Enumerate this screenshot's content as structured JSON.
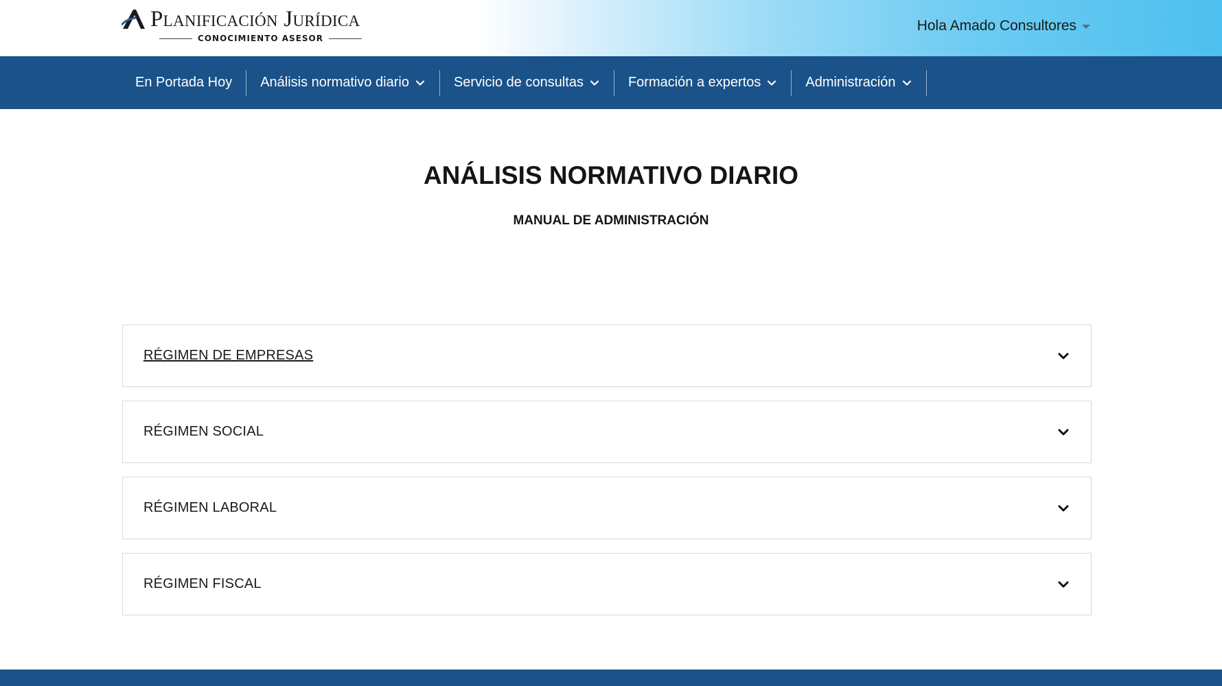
{
  "header": {
    "logo_title": "Planificación Jurídica",
    "logo_subtitle": "CONOCIMIENTO ASESOR",
    "user_greeting": "Hola Amado Consultores"
  },
  "nav": {
    "items": [
      {
        "label": "En Portada Hoy",
        "has_dropdown": false
      },
      {
        "label": "Análisis normativo diario",
        "has_dropdown": true
      },
      {
        "label": "Servicio de consultas",
        "has_dropdown": true
      },
      {
        "label": "Formación a expertos",
        "has_dropdown": true
      },
      {
        "label": "Administración",
        "has_dropdown": true
      }
    ]
  },
  "page": {
    "title": "ANÁLISIS NORMATIVO DIARIO",
    "subtitle": "MANUAL DE ADMINISTRACIÓN"
  },
  "accordion": {
    "items": [
      {
        "label": "RÉGIMEN DE EMPRESAS",
        "hovered": true
      },
      {
        "label": "RÉGIMEN SOCIAL"
      },
      {
        "label": "RÉGIMEN LABORAL"
      },
      {
        "label": "RÉGIMEN FISCAL"
      }
    ]
  },
  "colors": {
    "nav_background": "#1a5289",
    "header_gradient_end": "#4dc0ef",
    "logo_accent": "#1d5fa6"
  },
  "icons": {
    "logo_mark": "stylized-letter-a-icon",
    "user_caret": "caret-down-icon",
    "nav_dropdown": "chevron-down-icon",
    "accordion_toggle": "chevron-down-icon"
  }
}
